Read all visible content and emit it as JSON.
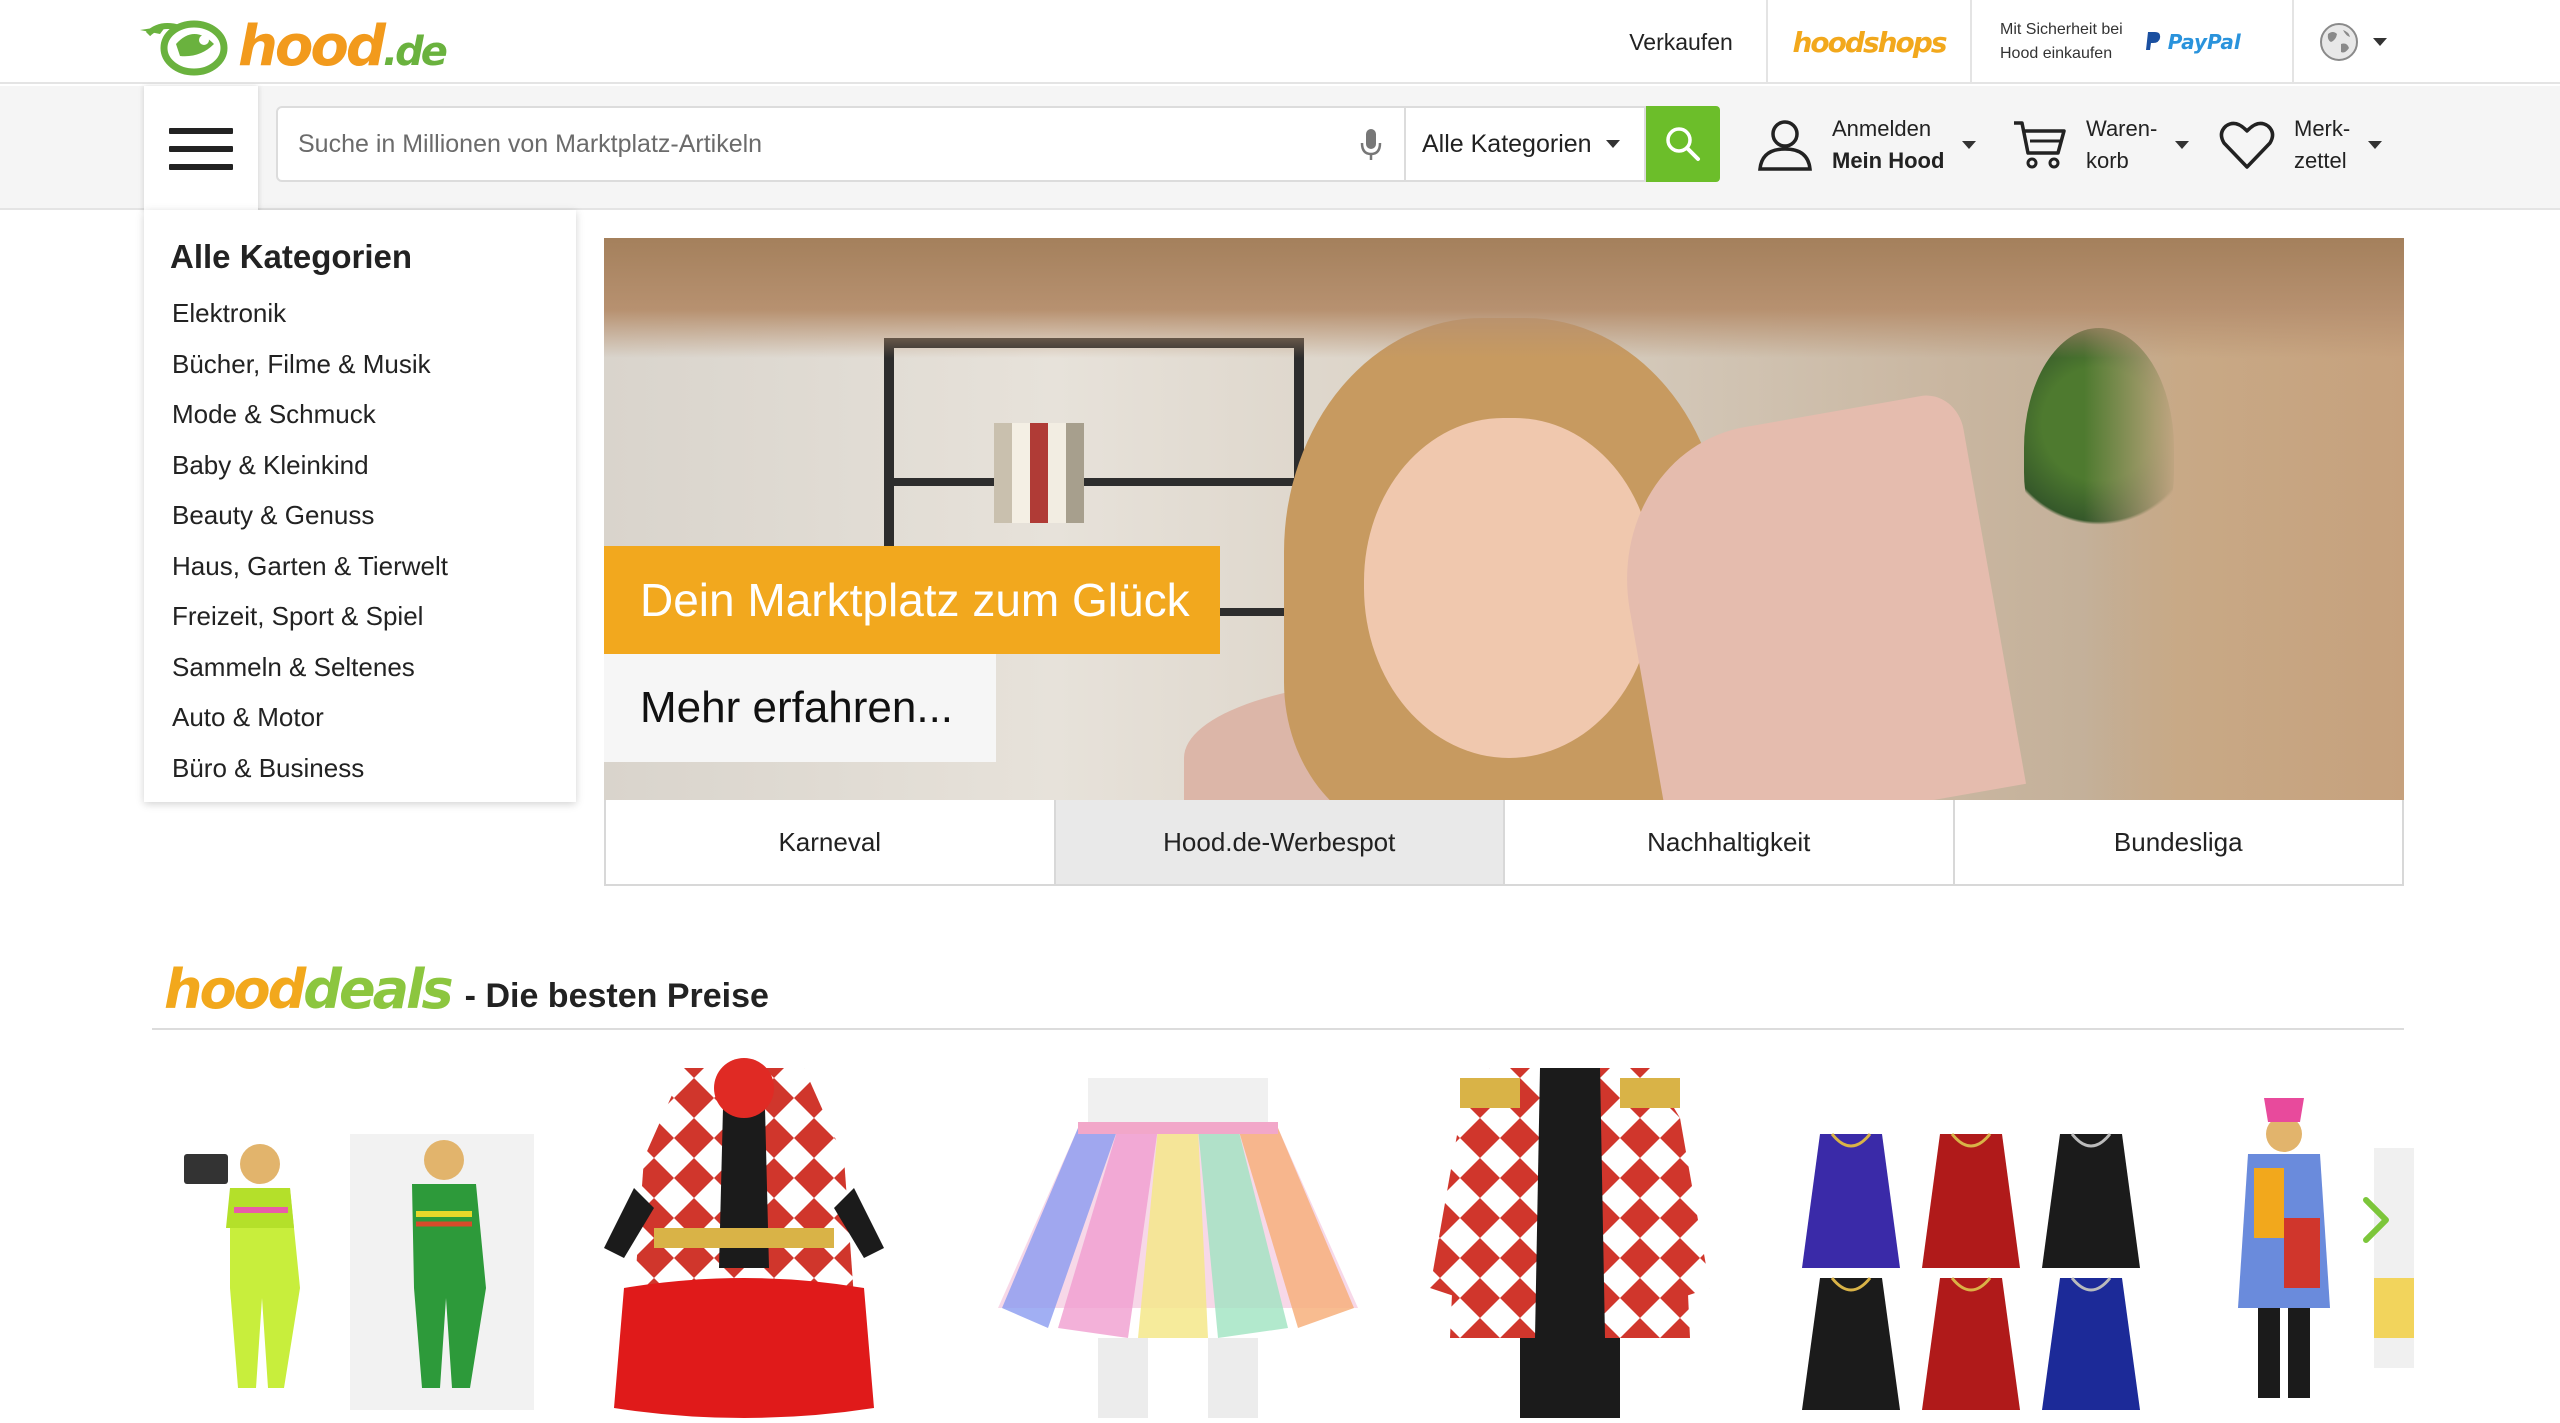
{
  "header": {
    "logo_text": "hood",
    "logo_suffix": ".de",
    "sell_label": "Verkaufen",
    "hoodshops_label": "hoodshops",
    "paypal_note_line1": "Mit Sicherheit bei",
    "paypal_note_line2": "Hood einkaufen",
    "paypal_label_a": "Pay",
    "paypal_label_b": "Pal",
    "globe_icon": "globe-icon"
  },
  "search": {
    "placeholder": "Suche in Millionen von Marktplatz-Artikeln",
    "value": "",
    "category_selected": "Alle Kategorien"
  },
  "nav": {
    "login_line1": "Anmelden",
    "login_line2": "Mein Hood",
    "cart_line1": "Waren-",
    "cart_line2": "korb",
    "wish_line1": "Merk-",
    "wish_line2": "zettel"
  },
  "categories": {
    "title": "Alle Kategorien",
    "items": [
      {
        "label": "Elektronik"
      },
      {
        "label": "Bücher, Filme & Musik"
      },
      {
        "label": "Mode & Schmuck"
      },
      {
        "label": "Baby & Kleinkind"
      },
      {
        "label": "Beauty & Genuss"
      },
      {
        "label": "Haus, Garten & Tierwelt"
      },
      {
        "label": "Freizeit, Sport & Spiel"
      },
      {
        "label": "Sammeln & Seltenes"
      },
      {
        "label": "Auto & Motor"
      },
      {
        "label": "Büro & Business"
      }
    ]
  },
  "hero": {
    "headline": "Dein Marktplatz zum Glück",
    "cta": "Mehr erfahren..."
  },
  "tabs": [
    {
      "label": "Karneval",
      "active": false
    },
    {
      "label": "Hood.de-Werbespot",
      "active": true
    },
    {
      "label": "Nachhaltigkeit",
      "active": false
    },
    {
      "label": "Bundesliga",
      "active": false
    }
  ],
  "deals": {
    "logo_a": "hood",
    "logo_b": "deals",
    "subtitle": "- Die besten Preise"
  },
  "colors": {
    "brand_orange": "#f2a81c",
    "brand_green": "#6cbe2a",
    "paypal_blue": "#1a4fa0"
  }
}
